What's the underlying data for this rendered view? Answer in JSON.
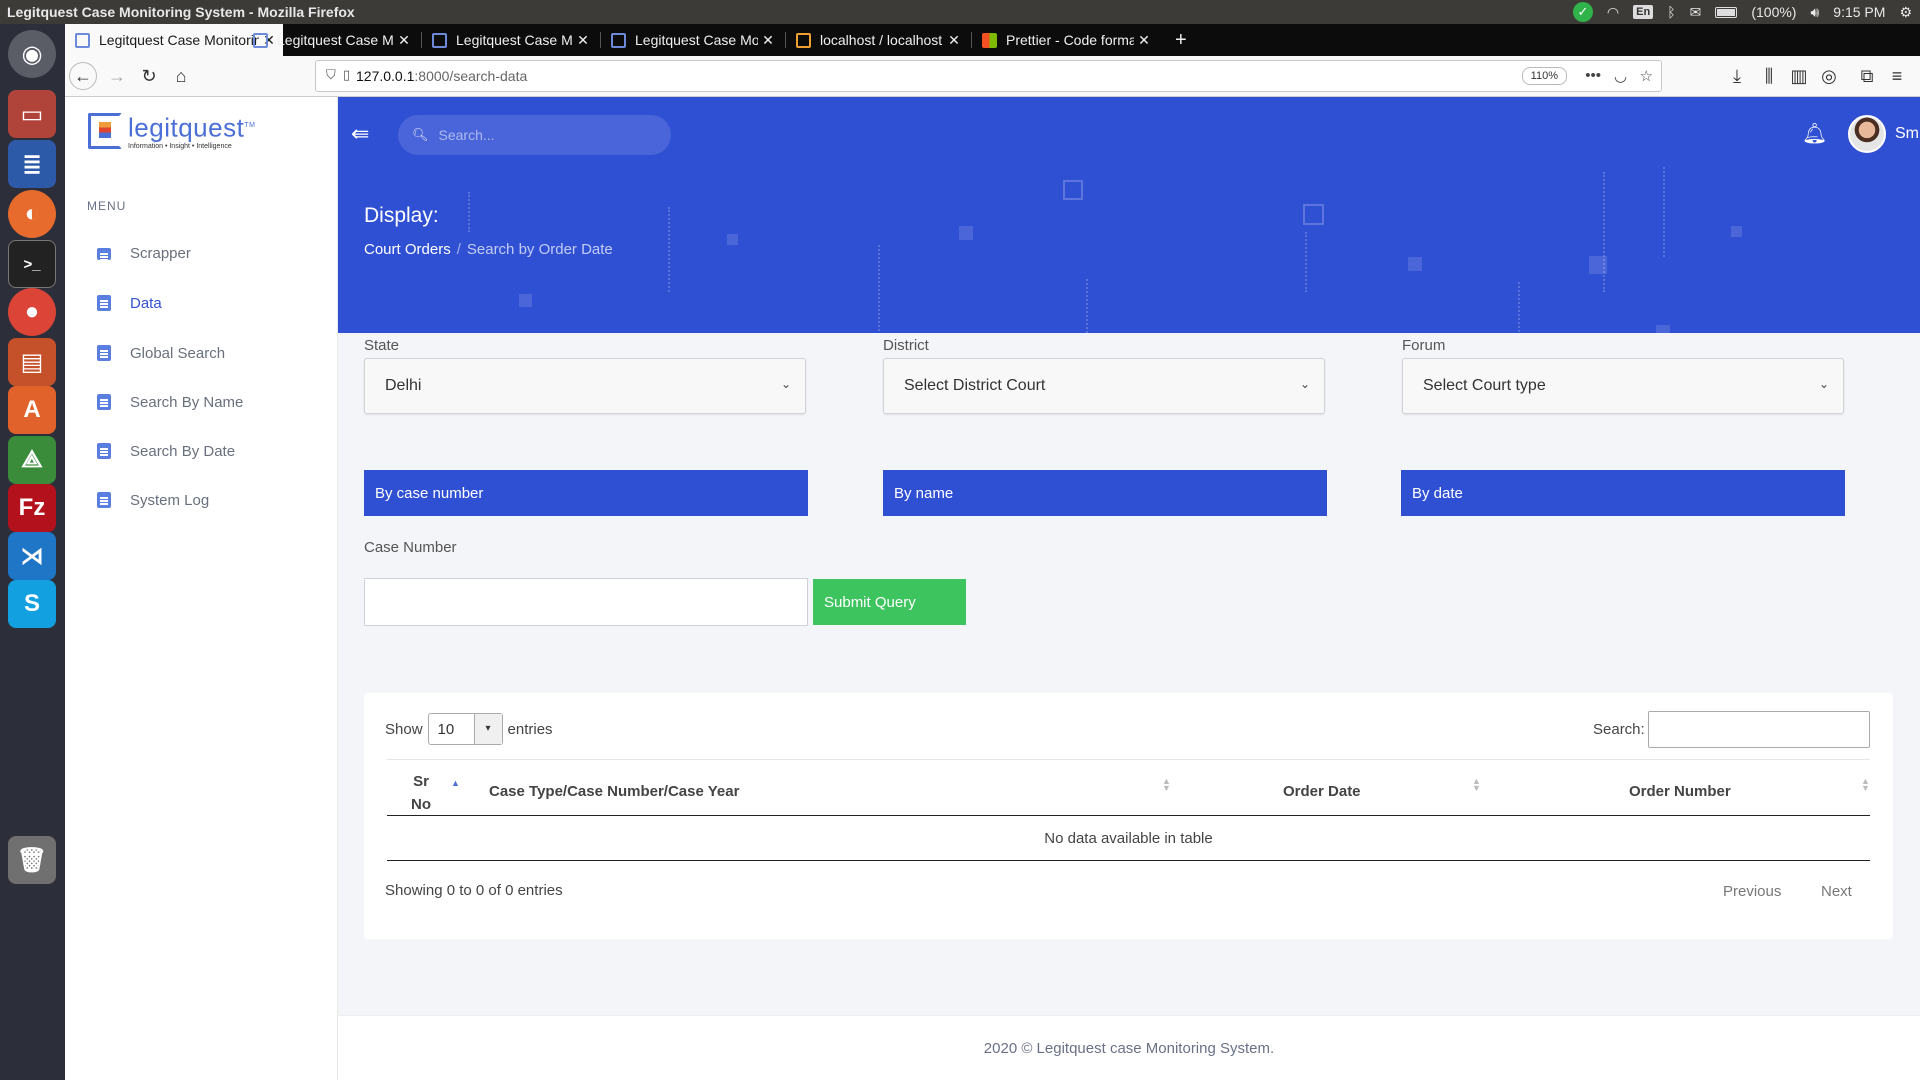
{
  "os": {
    "window_title": "Legitquest Case Monitoring System - Mozilla Firefox",
    "keyboard": "En",
    "battery": "(100%)",
    "clock": "9:15 PM"
  },
  "browser": {
    "tabs": [
      {
        "label": "Legitquest Case Monitoring System",
        "active": true
      },
      {
        "label": "Legitquest Case Monitoring System",
        "active": false
      },
      {
        "label": "Legitquest Case Monitoring System",
        "active": false
      },
      {
        "label": "Legitquest Case Monitoring System",
        "active": false
      },
      {
        "label": "localhost / localhost / demo",
        "active": false
      },
      {
        "label": "Prettier - Code formatter",
        "active": false
      }
    ],
    "new_tab": "+",
    "url_host": "127.0.0.1",
    "url_path": ":8000/search-data",
    "zoom": "110%"
  },
  "sidebar": {
    "logo_word": "legitquest",
    "logo_tm": "TM",
    "logo_tagline": "Information • Insight • Intelligence",
    "menu_heading": "MENU",
    "items": [
      {
        "label": "Scrapper",
        "icon": "briefcase-icon"
      },
      {
        "label": "Data",
        "icon": "document-icon",
        "active": true
      },
      {
        "label": "Global Search",
        "icon": "document-icon"
      },
      {
        "label": "Search By Name",
        "icon": "document-icon"
      },
      {
        "label": "Search By Date",
        "icon": "document-icon"
      },
      {
        "label": "System Log",
        "icon": "document-icon"
      }
    ]
  },
  "header": {
    "search_placeholder": "Search...",
    "user_name": "Smith",
    "page_heading": "Display:",
    "breadcrumb": [
      "Court Orders",
      "Search by Order Date"
    ]
  },
  "filters": {
    "state": {
      "label": "State",
      "value": "Delhi"
    },
    "district": {
      "label": "District",
      "value": "Select District Court"
    },
    "forum": {
      "label": "Forum",
      "value": "Select Court type"
    }
  },
  "search_modes": [
    "By case number",
    "By name",
    "By date"
  ],
  "case_form": {
    "label": "Case Number",
    "value": "",
    "submit_label": "Submit Query"
  },
  "table": {
    "show_label": "Show",
    "page_length": "10",
    "entries_label": "entries",
    "search_label": "Search:",
    "columns": [
      "Sr No",
      "Case Type/Case Number/Case Year",
      "Order Date",
      "Order Number"
    ],
    "empty_message": "No data available in table",
    "info": "Showing 0 to 0 of 0 entries",
    "prev_label": "Previous",
    "next_label": "Next"
  },
  "footer": {
    "text": "2020 © Legitquest case Monitoring System."
  },
  "colors": {
    "primary": "#3050d4",
    "submit": "#3ec45e",
    "sidebar_bg": "#ffffff",
    "page_bg": "#f4f5f8"
  }
}
